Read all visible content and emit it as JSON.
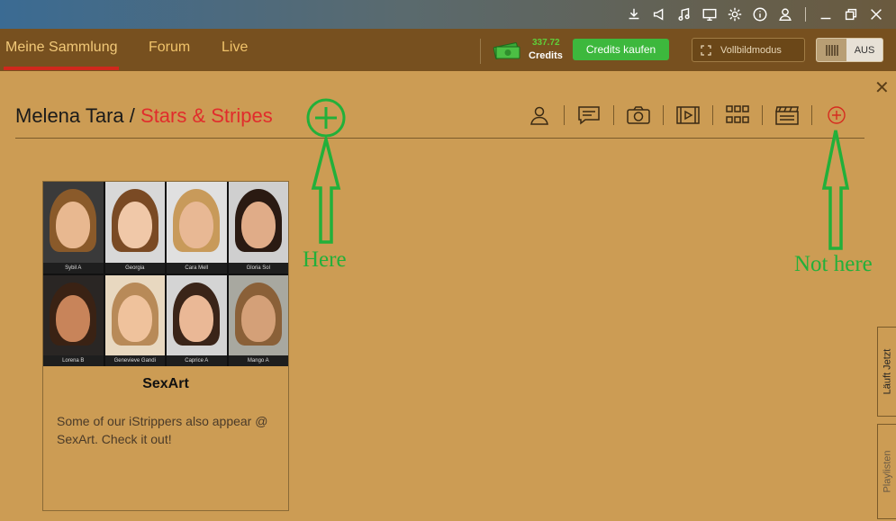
{
  "window": {
    "icons": [
      "download-icon",
      "megaphone-icon",
      "music-icon",
      "monitor-icon",
      "gear-icon",
      "info-icon",
      "user-icon",
      "minimize-icon",
      "restore-icon",
      "close-icon"
    ]
  },
  "nav": {
    "tabs": [
      {
        "label": "Meine Sammlung",
        "active": true
      },
      {
        "label": "Forum"
      },
      {
        "label": "Live"
      }
    ],
    "credits_value": "337.72",
    "credits_label": "Credits",
    "buy_label": "Credits kaufen",
    "fullscreen_label": "Vollbildmodus",
    "toggle_state": "AUS"
  },
  "content": {
    "breadcrumb_main": "Melena Tara",
    "breadcrumb_sep": " / ",
    "breadcrumb_sub": "Stars & Stripes",
    "annotations": {
      "here": "Here",
      "not_here": "Not here"
    },
    "card": {
      "title": "SexArt",
      "description": "Some of our iStrippers also appear @ SexArt. Check it out!",
      "models": [
        "Sybil A",
        "Georgia",
        "Cara Mell",
        "Gloria Sol",
        "Lorena B",
        "Genevieve Gandi",
        "Caprice A",
        "Mango A"
      ]
    }
  },
  "side_tabs": [
    "Läuft Jetzt",
    "Playlisten"
  ],
  "colors": {
    "accent_red": "#e12c2c",
    "annotation_green": "#22b03a",
    "buy_green": "#3db83d",
    "content_bg": "#cc9c54",
    "nav_bg": "#77501f"
  }
}
